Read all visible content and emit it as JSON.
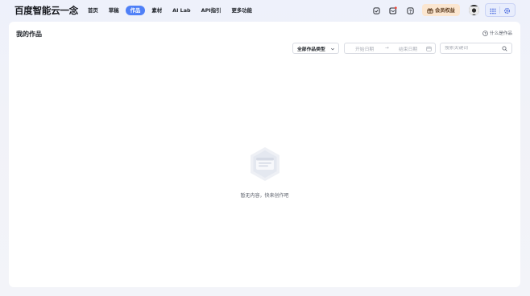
{
  "brand": {
    "logo_text": "百度智能云一念"
  },
  "nav": {
    "items": [
      {
        "label": "首页",
        "active": false
      },
      {
        "label": "草稿",
        "active": false
      },
      {
        "label": "作品",
        "active": true
      },
      {
        "label": "素材",
        "active": false
      },
      {
        "label": "AI Lab",
        "active": false
      },
      {
        "label": "API指引",
        "active": false
      },
      {
        "label": "更多功能",
        "active": false
      }
    ]
  },
  "toolbar": {
    "icons": [
      "edit-check-icon",
      "message-notification-icon",
      "help-chat-icon"
    ],
    "member_label": "会员权益",
    "member_icon": "gift-icon",
    "accent": "#4f80f7",
    "member_bg": "#fbe6d0"
  },
  "main": {
    "title": "我的作品",
    "help_label": "什么是作品",
    "filters": {
      "type_select": "全部作品类型",
      "date_start_placeholder": "开始日期",
      "date_separator": "→",
      "date_end_placeholder": "结束日期",
      "search_placeholder": "搜索关键词"
    },
    "empty_state": "暂无内容，快来创作吧"
  }
}
